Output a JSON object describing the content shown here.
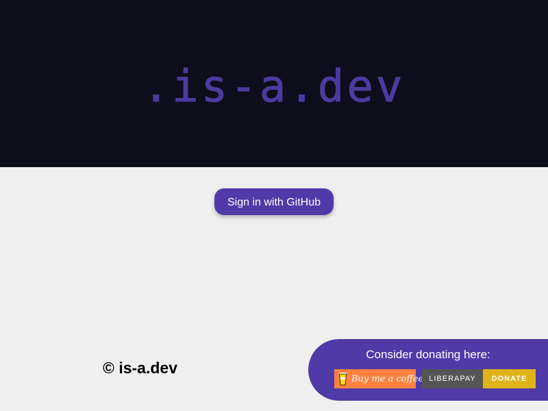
{
  "hero": {
    "logo_text": ".is-a.dev"
  },
  "auth": {
    "signin_label": "Sign in with GitHub"
  },
  "footer": {
    "copyright": "© is-a.dev"
  },
  "donate": {
    "title": "Consider donating here:",
    "buymeacoffee_label": "Buy me a coffee",
    "liberapay_left": "LIBERAPAY",
    "liberapay_right": "DONATE"
  },
  "colors": {
    "hero_bg": "#0e0d1b",
    "brand_purple": "#4f3aa8",
    "page_bg": "#efefef",
    "bmc_orange": "#ff813f",
    "liberapay_gray": "#555555",
    "liberapay_yellow": "#dfb317"
  },
  "icons": {
    "coffee": "coffee-cup-icon"
  }
}
